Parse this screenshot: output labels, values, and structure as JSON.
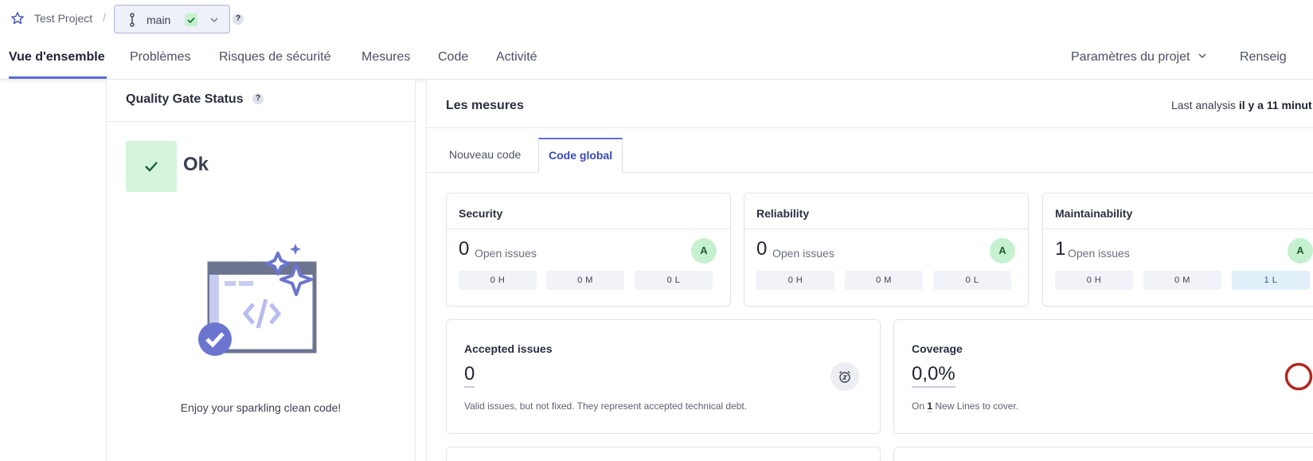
{
  "header": {
    "project_name": "Test Project",
    "separator": "/",
    "branch": "main",
    "help": "?"
  },
  "nav": {
    "tabs": [
      "Vue d'ensemble",
      "Problèmes",
      "Risques de sécurité",
      "Mesures",
      "Code",
      "Activité"
    ],
    "project_settings": "Paramètres du projet",
    "info": "Renseig"
  },
  "quality_gate": {
    "title": "Quality Gate Status",
    "help": "?",
    "status": "Ok",
    "message": "Enjoy your sparkling clean code!"
  },
  "measures": {
    "title": "Les mesures",
    "last_analysis_label": "Last analysis",
    "last_analysis_value": "il y a 11 minut",
    "tabs": [
      "Nouveau code",
      "Code global"
    ],
    "active_tab": "Code global"
  },
  "cards": [
    {
      "title": "Security",
      "count": "0",
      "label": "Open issues",
      "grade": "A",
      "sev": [
        "0 H",
        "0 M",
        "0 L"
      ]
    },
    {
      "title": "Reliability",
      "count": "0",
      "label": "Open issues",
      "grade": "A",
      "sev": [
        "0 H",
        "0 M",
        "0 L"
      ]
    },
    {
      "title": "Maintainability",
      "count": "1",
      "label": "Open issues",
      "grade": "A",
      "sev": [
        "0 H",
        "0 M",
        "1 L"
      ]
    }
  ],
  "accepted": {
    "title": "Accepted issues",
    "value": "0",
    "desc": "Valid issues, but not fixed. They represent accepted technical debt."
  },
  "coverage": {
    "title": "Coverage",
    "value": "0,0%",
    "desc_prefix": "On",
    "desc_count": "1",
    "desc_suffix": "New Lines to cover."
  },
  "colors": {
    "accent": "#5d6cd0",
    "ok_bg": "#d4f5dc",
    "grade_bg": "#c6f1d0",
    "coverage_ring": "#b3261e"
  },
  "icons": [
    "star-icon",
    "branch-icon",
    "check-icon",
    "chevron-down-icon",
    "help-icon",
    "clock-icon",
    "coverage-ring-icon"
  ]
}
